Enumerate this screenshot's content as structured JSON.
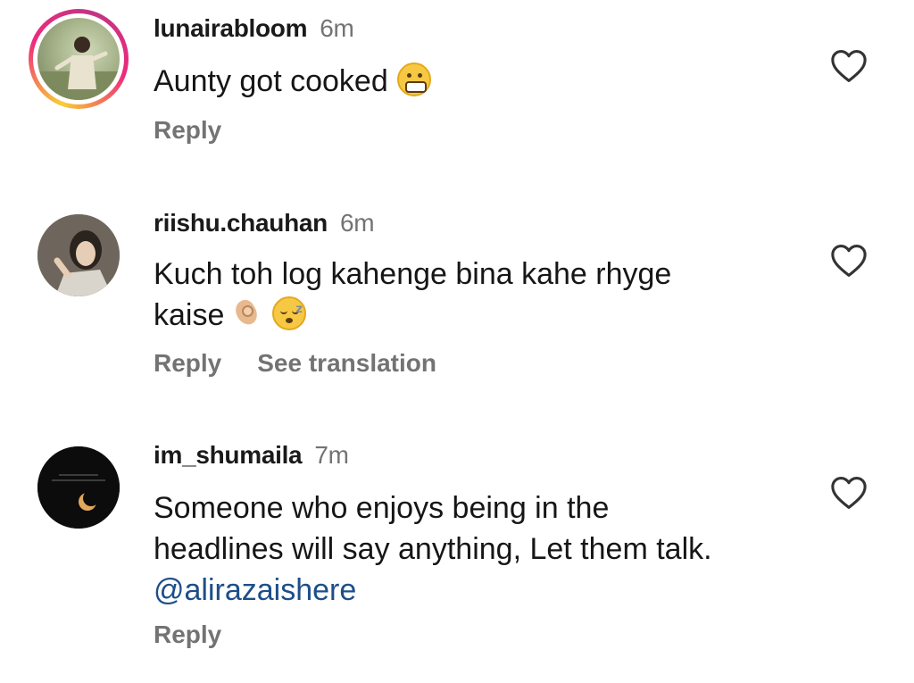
{
  "comments": [
    {
      "username": "lunairabloom",
      "time": "6m",
      "text_lines": [
        "Aunty got cooked"
      ],
      "emojis": [
        "grimacing-face-emoji"
      ],
      "mention": "",
      "actions": [
        "Reply"
      ],
      "avatar_story_ring": true
    },
    {
      "username": "riishu.chauhan",
      "time": "6m",
      "text_lines": [
        "Kuch toh log kahenge bina kahe rhyge",
        "kaise"
      ],
      "emojis": [
        "pinched-fingers-emoji",
        "sleeping-face-emoji"
      ],
      "mention": "",
      "actions": [
        "Reply",
        "See translation"
      ],
      "avatar_story_ring": false
    },
    {
      "username": "im_shumaila",
      "time": "7m",
      "text_lines": [
        "Someone who enjoys being in the",
        "headlines will say anything, Let them talk."
      ],
      "emojis": [],
      "mention": "@alirazaishere",
      "actions": [
        "Reply"
      ],
      "avatar_story_ring": false
    }
  ],
  "colors": {
    "text": "#161616",
    "secondary": "#737373",
    "mention": "#1d4e89",
    "story_ring": [
      "#f9ce34",
      "#ee2a7b",
      "#c13584"
    ]
  }
}
